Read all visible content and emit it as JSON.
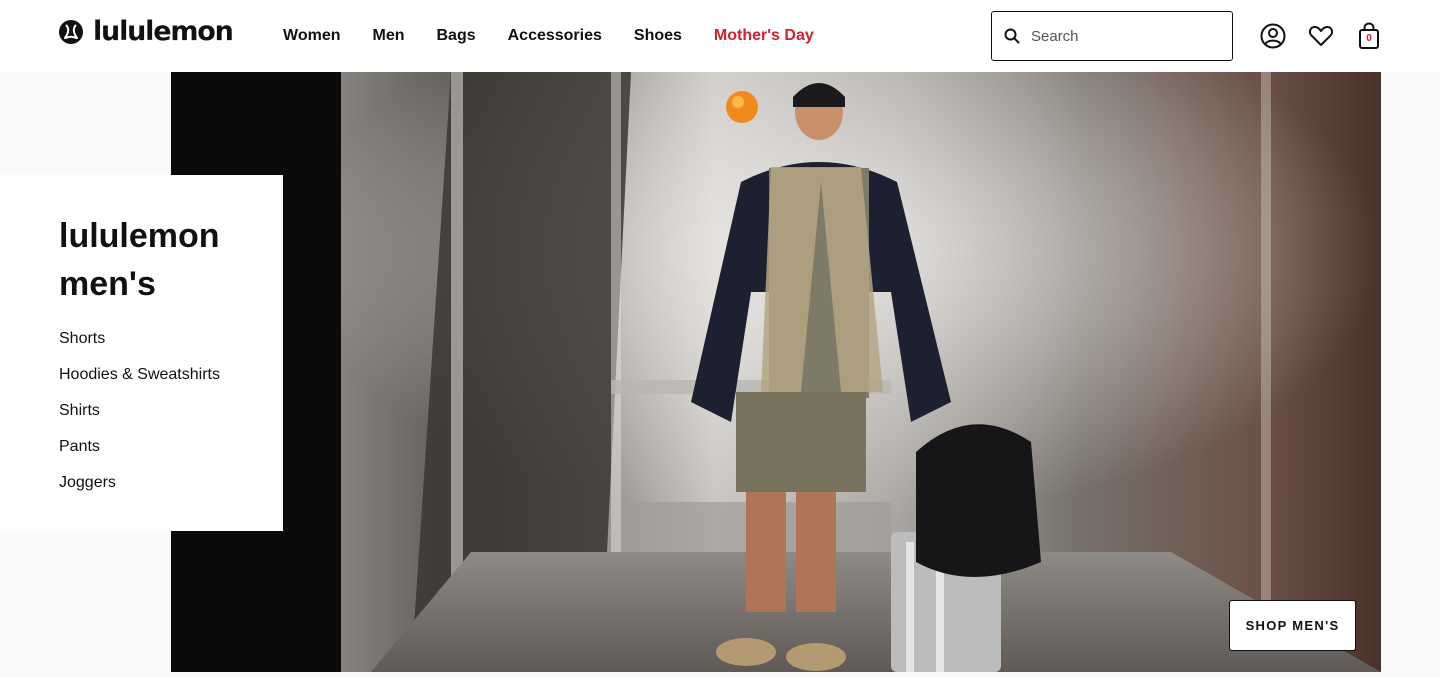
{
  "header": {
    "logo_text": "lululemon",
    "nav": [
      "Women",
      "Men",
      "Bags",
      "Accessories",
      "Shoes",
      "Mother's Day"
    ],
    "search_placeholder": "Search",
    "bag_count": "0"
  },
  "hero": {
    "heading": "lululemon men's",
    "categories": [
      "Shorts",
      "Hoodies & Sweatshirts",
      "Shirts",
      "Pants",
      "Joggers"
    ],
    "cta_label": "SHOP MEN'S"
  },
  "colors": {
    "promo": "#d22030",
    "text": "#111111",
    "background": "#fafafa"
  },
  "icons": [
    "lululemon-logo-icon",
    "search-icon",
    "account-icon",
    "heart-icon",
    "shopping-bag-icon"
  ]
}
